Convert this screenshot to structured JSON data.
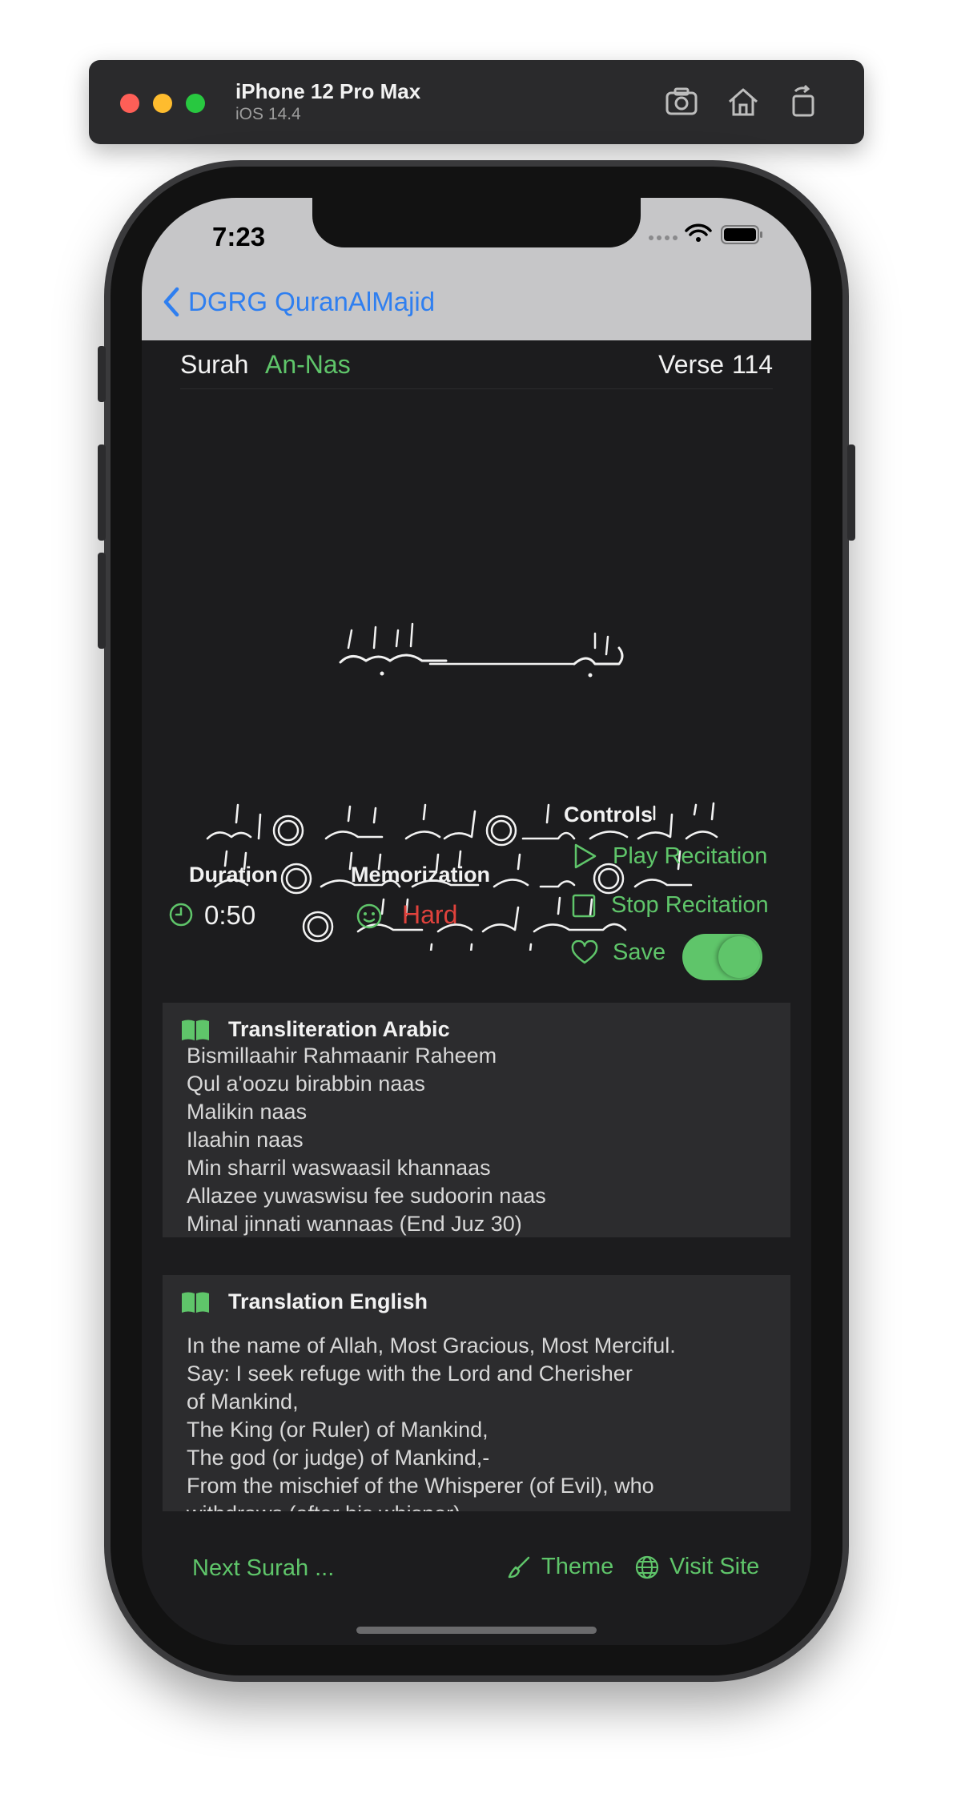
{
  "simulator": {
    "device_name": "iPhone 12 Pro Max",
    "os_version": "iOS 14.4",
    "buttons": [
      "screenshot-icon",
      "home-icon",
      "rotate-icon"
    ]
  },
  "status_bar": {
    "time": "7:23",
    "icons": [
      "cellular-icon",
      "wifi-icon",
      "battery-icon"
    ]
  },
  "nav": {
    "back_label": "DGRG QuranAlMajid"
  },
  "header": {
    "surah_label": "Surah",
    "surah_name": "An-Nas",
    "verse_label": "Verse",
    "verse_number": "114"
  },
  "stats": {
    "duration_title": "Duration",
    "duration_value": "0:50",
    "memorization_title": "Memorization",
    "memorization_value": "Hard"
  },
  "controls": {
    "title": "Controls",
    "play_label": "Play Recitation",
    "stop_label": "Stop Recitation",
    "save_label": "Save",
    "save_toggle_on": true
  },
  "transliteration": {
    "title": "Transliteration Arabic",
    "lines": [
      "Bismillaahir Rahmaanir Raheem",
      "Qul a'oozu birabbin naas",
      "Malikin naas",
      "Ilaahin naas",
      "Min sharril waswaasil khannaas",
      "Allazee yuwaswisu fee sudoorin naas",
      "Minal jinnati wannaas (End Juz 30)"
    ]
  },
  "translation": {
    "title": "Translation English",
    "lines": [
      "In the name of Allah, Most Gracious, Most Merciful.",
      "Say: I seek refuge with the Lord and Cherisher",
      "of Mankind,",
      "The King (or Ruler) of Mankind,",
      "The god (or judge) of Mankind,-",
      "From the mischief of the Whisperer (of Evil), who",
      "withdraws (after his whisper),-"
    ]
  },
  "bottom": {
    "next_label": "Next Surah ...",
    "theme_label": "Theme",
    "visit_label": "Visit Site"
  },
  "colors": {
    "accent_green": "#5fc56a",
    "link_blue": "#2f7ff0",
    "hard_red": "#e0423c",
    "background": "#1c1c1e",
    "card": "#2c2c2e"
  }
}
